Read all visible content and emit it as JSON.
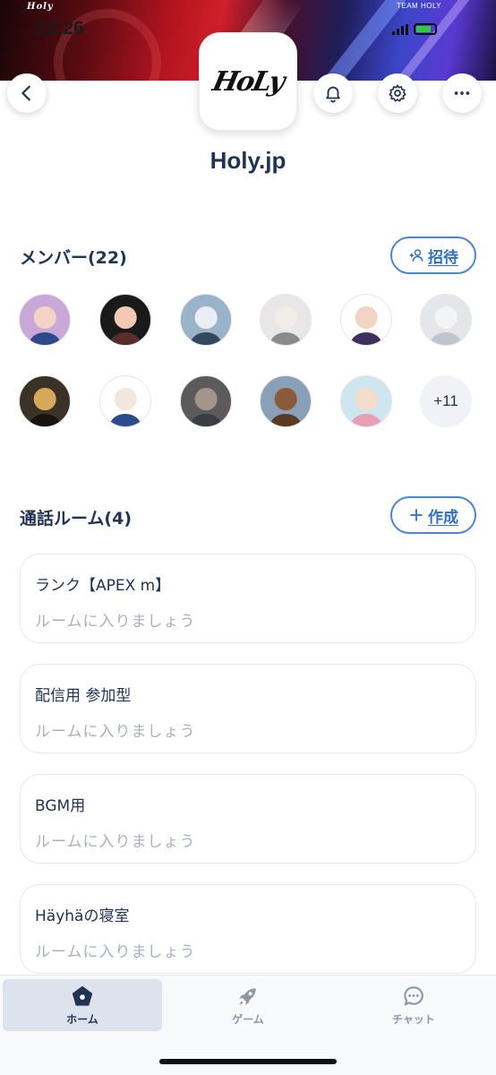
{
  "status_bar": {
    "time": "23:26"
  },
  "banner": {
    "mini_logo_text": "Holy",
    "team_label": "TEAM HOLY"
  },
  "header": {
    "back_icon": "chevron-left-icon",
    "bell_icon": "bell-icon",
    "settings_icon": "gear-icon",
    "more_icon": "ellipsis-icon"
  },
  "group": {
    "logo_text": "HoLy",
    "name": "Holy.jp"
  },
  "members": {
    "title": "メンバー(22)",
    "invite_label": "招待",
    "more_count": "+11",
    "avatars": [
      {
        "bg": "#c9a7d8",
        "face": "#f2d3c4",
        "body": "#2c4a8a"
      },
      {
        "bg": "#1a1a1a",
        "face": "#f1c9b4",
        "body": "#5a2d2d"
      },
      {
        "bg": "#9bb3c9",
        "face": "#e9eef5",
        "body": "#33485e"
      },
      {
        "bg": "#e8e6e6",
        "face": "#f0ece8",
        "body": "#8a8a8a"
      },
      {
        "bg": "#ffffff",
        "face": "#f2d4c4",
        "body": "#3e2f5e"
      },
      {
        "bg": "#e4e6ea",
        "face": "#f4f4f4",
        "body": "#c0c4cc"
      },
      {
        "bg": "#3a3226",
        "face": "#d6a85a",
        "body": "#17130f"
      },
      {
        "bg": "#ffffff",
        "face": "#f3e6dc",
        "body": "#2a4a8a"
      },
      {
        "bg": "#5c5a5a",
        "face": "#a4958a",
        "body": "#3a3d44"
      },
      {
        "bg": "#8a9fb8",
        "face": "#8a5a3a",
        "body": "#5a3a22"
      },
      {
        "bg": "#cde6f0",
        "face": "#f4dccb",
        "body": "#e89fb4"
      }
    ]
  },
  "rooms": {
    "title": "通話ルーム(4)",
    "create_label": "作成",
    "items": [
      {
        "name": "ランク【APEX m】",
        "subtitle": "ルームに入りましょう"
      },
      {
        "name": "配信用 参加型",
        "subtitle": "ルームに入りましょう"
      },
      {
        "name": "BGM用",
        "subtitle": "ルームに入りましょう"
      },
      {
        "name": "Häyhäの寝室",
        "subtitle": "ルームに入りましょう"
      }
    ]
  },
  "bottom_nav": {
    "items": [
      {
        "label": "ホーム",
        "icon": "home-icon",
        "active": true
      },
      {
        "label": "ゲーム",
        "icon": "rocket-icon",
        "active": false
      },
      {
        "label": "チャット",
        "icon": "chat-icon",
        "active": false
      }
    ],
    "active_color": "#233354",
    "inactive_color": "#8c97ab"
  }
}
